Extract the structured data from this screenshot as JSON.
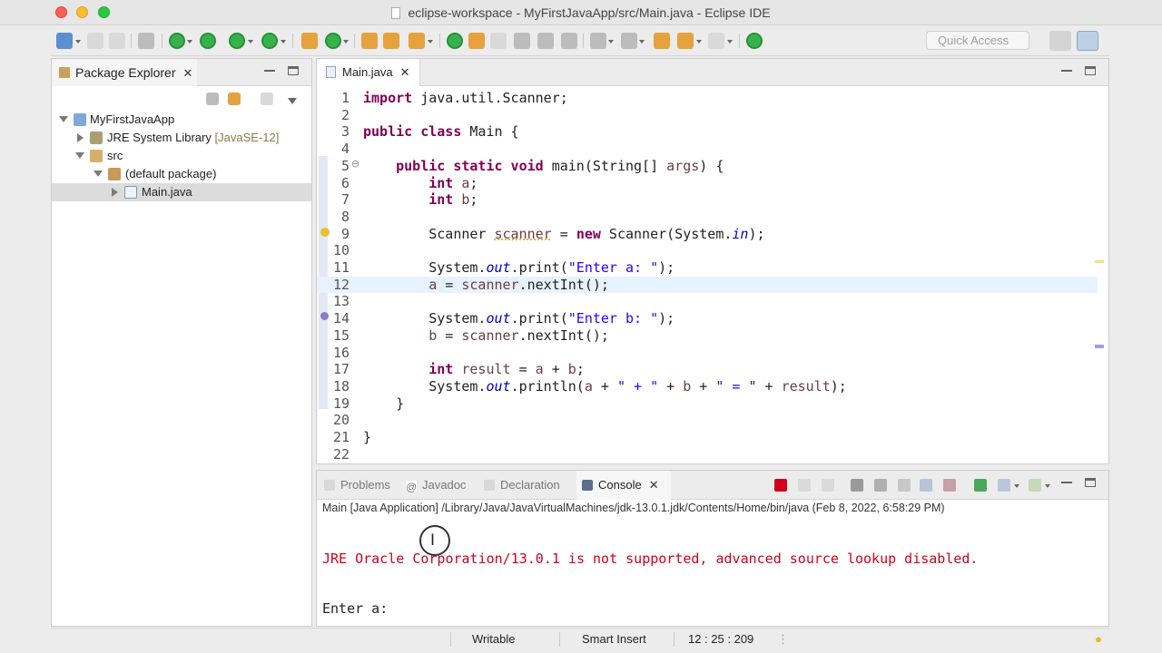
{
  "window": {
    "title": "eclipse-workspace - MyFirstJavaApp/src/Main.java - Eclipse IDE"
  },
  "toolbar": {
    "quick_access_placeholder": "Quick Access"
  },
  "package_explorer": {
    "tab_label": "Package Explorer",
    "tree": [
      {
        "label": "MyFirstJavaApp",
        "level": 0,
        "expanded": true,
        "icon": "java-project-icon"
      },
      {
        "label": "JRE System Library",
        "decoration": "[JavaSE-12]",
        "level": 1,
        "expanded": false,
        "icon": "library-icon"
      },
      {
        "label": "src",
        "level": 1,
        "expanded": true,
        "icon": "source-folder-icon"
      },
      {
        "label": "(default package)",
        "level": 2,
        "expanded": true,
        "icon": "package-icon"
      },
      {
        "label": "Main.java",
        "level": 3,
        "expanded": false,
        "icon": "java-file-icon",
        "selected": true
      }
    ]
  },
  "editor": {
    "tab_label": "Main.java",
    "lines": [
      {
        "n": "1",
        "html": "<span class=\"kw\">import</span> java.util.Scanner;"
      },
      {
        "n": "2",
        "html": ""
      },
      {
        "n": "3",
        "html": "<span class=\"kw\">public class</span> Main {"
      },
      {
        "n": "4",
        "html": ""
      },
      {
        "n": "5",
        "html": "    <span class=\"kw\">public static void</span> main(String[] <span class=\"loc\">args</span>) {"
      },
      {
        "n": "6",
        "html": "        <span class=\"kw\">int</span> <span class=\"loc\">a</span>;"
      },
      {
        "n": "7",
        "html": "        <span class=\"kw\">int</span> <span class=\"loc\">b</span>;"
      },
      {
        "n": "8",
        "html": ""
      },
      {
        "n": "9",
        "html": "        Scanner <span class=\"warn-local\">scanner</span> = <span class=\"kw\">new</span> Scanner(System.<span class=\"fld\">in</span>);"
      },
      {
        "n": "10",
        "html": ""
      },
      {
        "n": "11",
        "html": "        System.<span class=\"fld\">out</span>.print(<span class=\"str\">\"Enter a: \"</span>);"
      },
      {
        "n": "12",
        "html": "        <span class=\"loc\">a</span> = <span class=\"loc\">scanner</span>.nextInt();"
      },
      {
        "n": "13",
        "html": ""
      },
      {
        "n": "14",
        "html": "        System.<span class=\"fld\">out</span>.print(<span class=\"str\">\"Enter b: \"</span>);"
      },
      {
        "n": "15",
        "html": "        <span class=\"loc\">b</span> = <span class=\"loc\">scanner</span>.nextInt();"
      },
      {
        "n": "16",
        "html": ""
      },
      {
        "n": "17",
        "html": "        <span class=\"kw\">int</span> <span class=\"loc\">result</span> = <span class=\"loc\">a</span> + <span class=\"loc\">b</span>;"
      },
      {
        "n": "18",
        "html": "        System.<span class=\"fld\">out</span>.println(<span class=\"loc\">a</span> + <span class=\"str\">\" + \"</span> + <span class=\"loc\">b</span> + <span class=\"str\">\" = \"</span> + <span class=\"loc\">result</span>);"
      },
      {
        "n": "19",
        "html": "    }"
      },
      {
        "n": "20",
        "html": ""
      },
      {
        "n": "21",
        "html": "}"
      },
      {
        "n": "22",
        "html": ""
      }
    ],
    "current_line": "12"
  },
  "bottom_panel": {
    "tabs": [
      {
        "label": "Problems",
        "icon": "problems-icon",
        "active": false
      },
      {
        "label": "Javadoc",
        "icon": "javadoc-icon",
        "active": false
      },
      {
        "label": "Declaration",
        "icon": "declaration-icon",
        "active": false
      },
      {
        "label": "Console",
        "icon": "console-icon",
        "active": true
      }
    ],
    "console_description": "Main [Java Application] /Library/Java/JavaVirtualMachines/jdk-13.0.1.jdk/Contents/Home/bin/java (Feb 8, 2022, 6:58:29 PM)",
    "output_error": "JRE Oracle Corporation/13.0.1 is not supported, advanced source lookup disabled.",
    "output_prompt": "Enter a: "
  },
  "status_bar": {
    "mode": "Writable",
    "insert_mode": "Smart Insert",
    "position": "12 : 25 : 209"
  },
  "colors": {
    "keyword": "#7f0055",
    "string": "#2a00ff",
    "field": "#0000c0",
    "error": "#d0021b"
  }
}
